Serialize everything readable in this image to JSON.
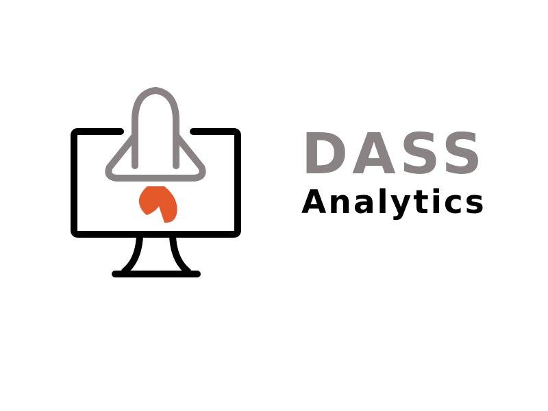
{
  "brand": {
    "name": "DASS",
    "tagline": "Analytics"
  },
  "icons": {
    "monitor": "monitor-icon",
    "rocket": "rocket-icon",
    "flame": "flame-icon"
  },
  "colors": {
    "background": "#ffffff",
    "monitor": "#000000",
    "rocket": "#8a8383",
    "flame": "#e3592a",
    "name_text": "#8a8383",
    "tagline_text": "#000000"
  }
}
